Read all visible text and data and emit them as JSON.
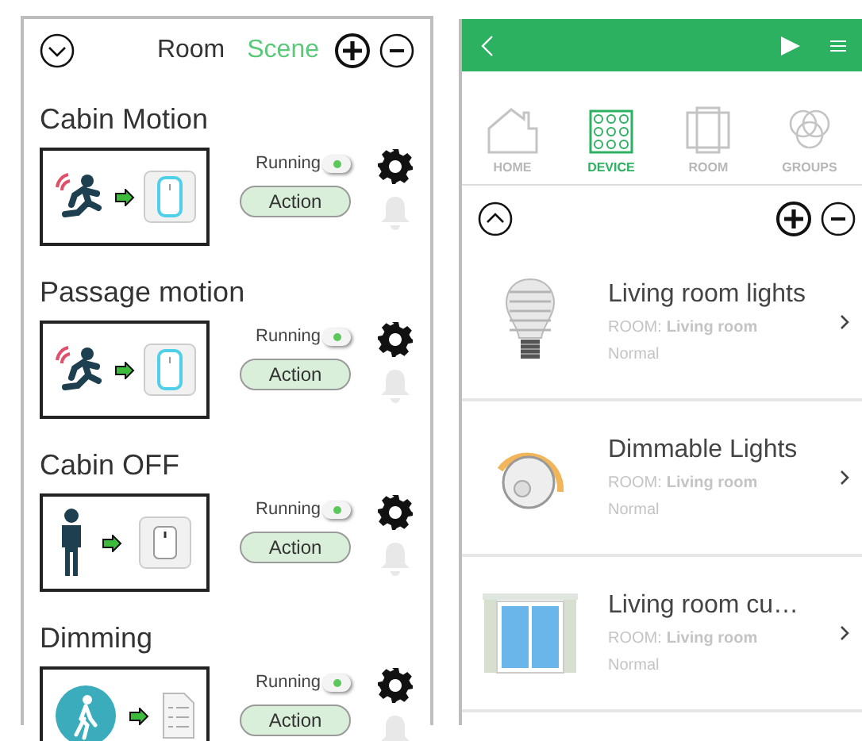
{
  "scene_panel": {
    "tabs": [
      {
        "label": "Room",
        "selected": false
      },
      {
        "label": "Scene",
        "selected": true
      }
    ],
    "scenes": [
      {
        "title": "Cabin Motion",
        "preview": [
          {
            "kind": "running"
          },
          {
            "kind": "switch"
          }
        ],
        "running_label": "Running",
        "running": true,
        "action": "Action"
      },
      {
        "title": "Passage motion",
        "preview": [
          {
            "kind": "running"
          },
          {
            "kind": "switch"
          }
        ],
        "running_label": "Running",
        "running": true,
        "action": "Action"
      },
      {
        "title": "Cabin OFF",
        "preview": [
          {
            "kind": "standing"
          },
          {
            "kind": "plug"
          }
        ],
        "running_label": "Running",
        "running": true,
        "action": "Action"
      },
      {
        "title": "Dimming",
        "preview": [
          {
            "kind": "walker"
          },
          {
            "kind": "list"
          }
        ],
        "running_label": "Running",
        "running": true,
        "action": "Action"
      }
    ]
  },
  "device_panel": {
    "nav_tabs": [
      {
        "label": "HOME",
        "kind": "home",
        "selected": false
      },
      {
        "label": "DEVICE",
        "kind": "device",
        "selected": true
      },
      {
        "label": "ROOM",
        "kind": "room",
        "selected": false
      },
      {
        "label": "GROUPS",
        "kind": "groups",
        "selected": false
      }
    ],
    "devices": [
      {
        "name": "Living room lights",
        "kind": "bulb",
        "room_label": "ROOM:",
        "room": "Living room",
        "status": "Normal"
      },
      {
        "name": "Dimmable Lights",
        "kind": "dimmer",
        "room_label": "ROOM:",
        "room": "Living room",
        "status": "Normal"
      },
      {
        "name": "Living room cu…",
        "kind": "window",
        "room_label": "ROOM:",
        "room": "Living room",
        "status": "Normal"
      }
    ]
  }
}
